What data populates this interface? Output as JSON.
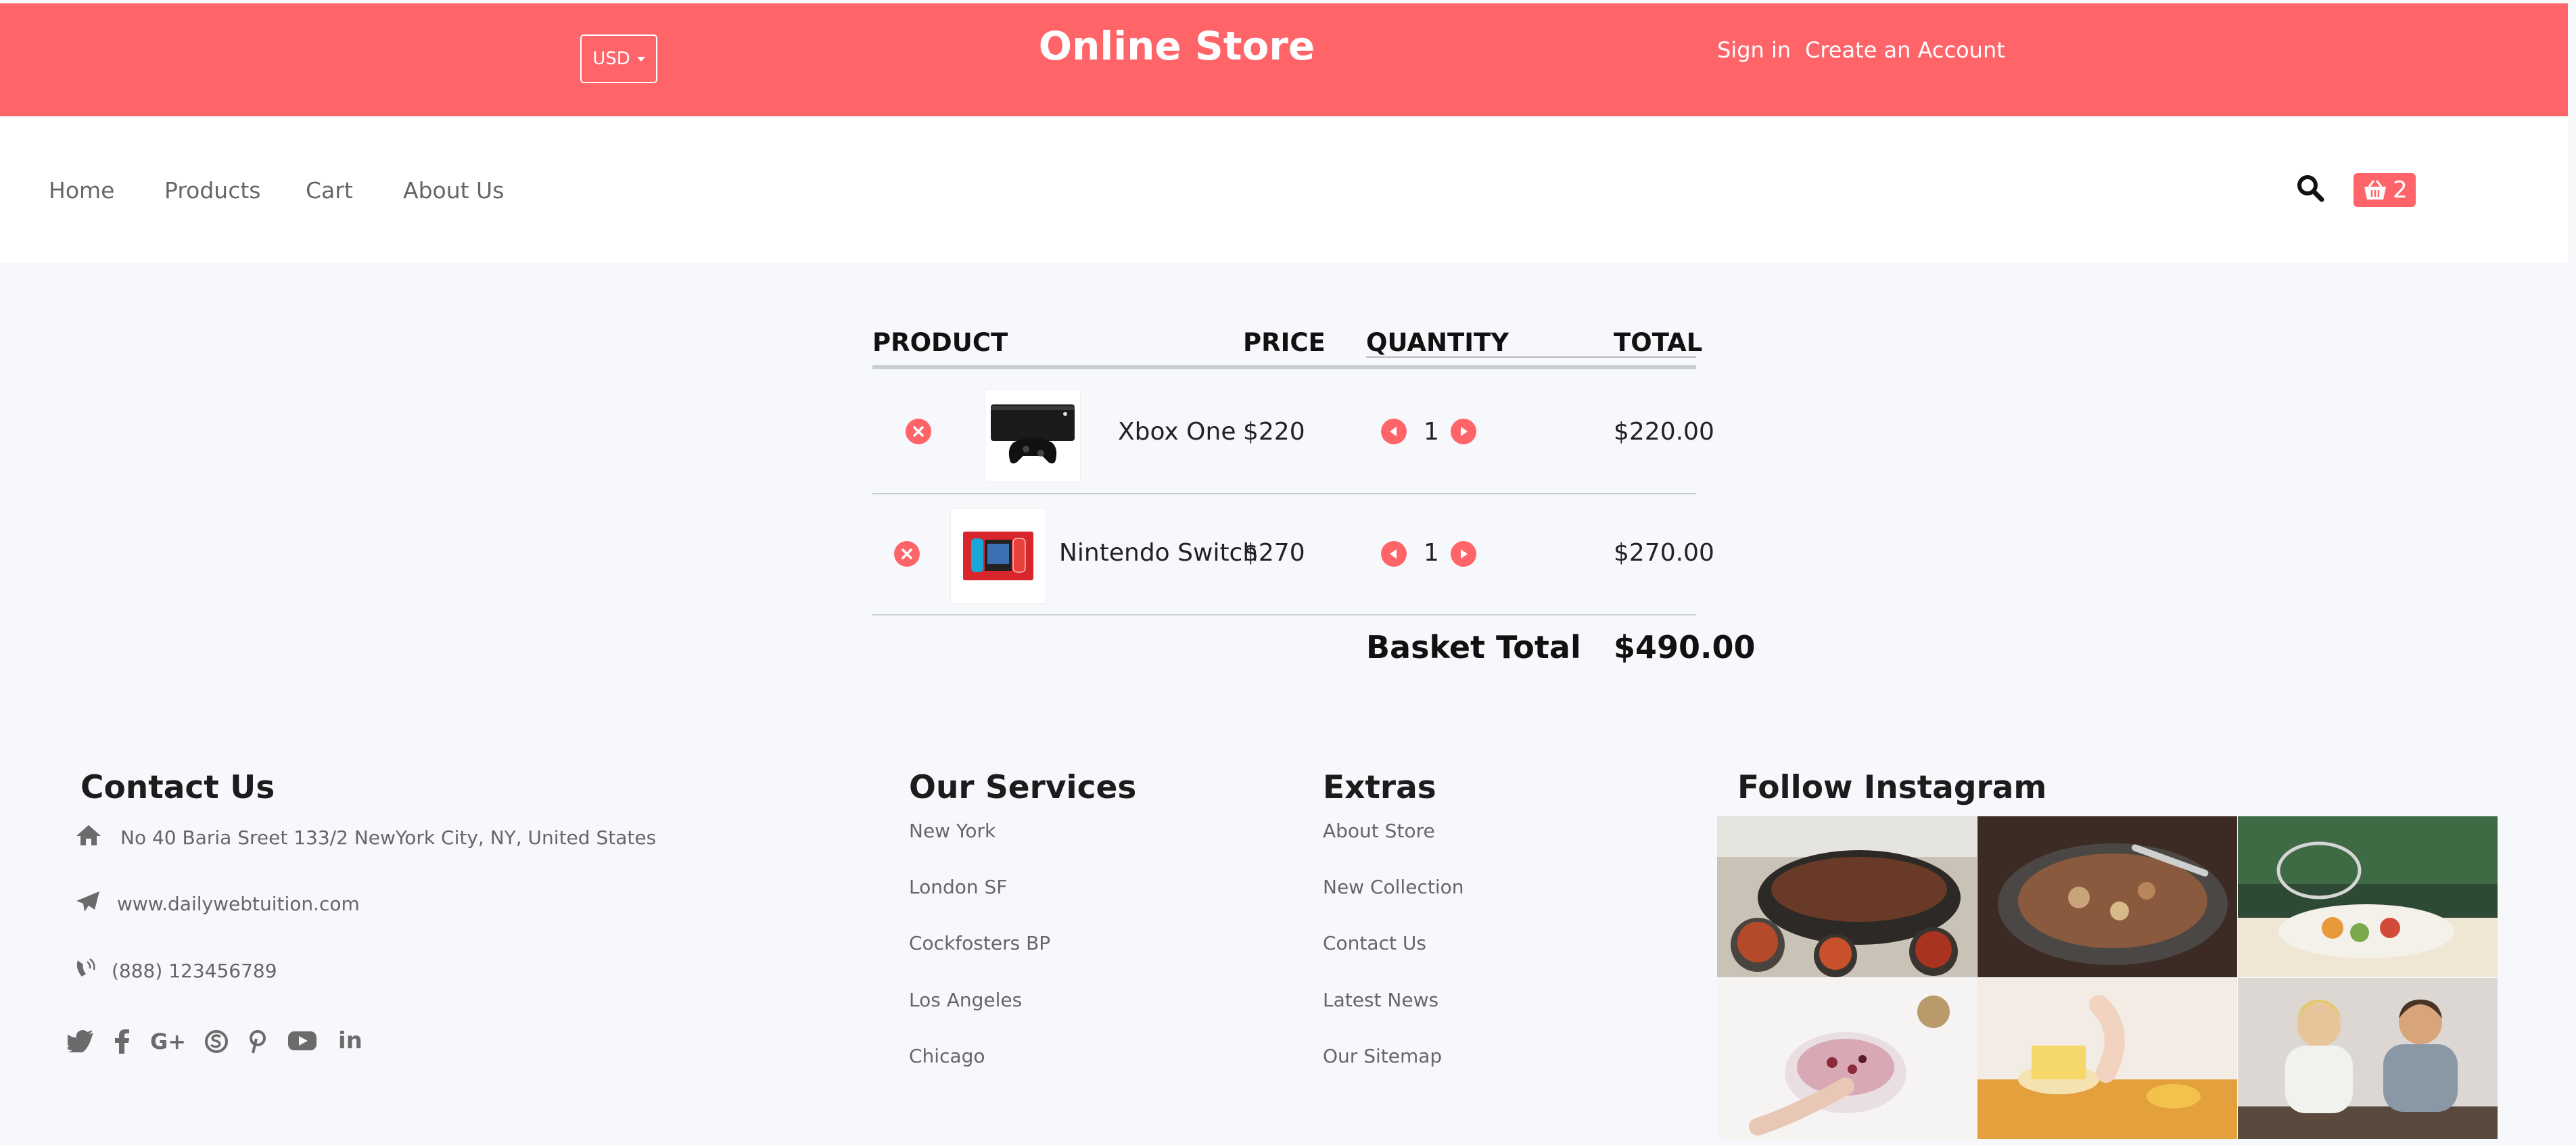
{
  "header": {
    "currency": "USD",
    "brand": "Online Store",
    "sign_in": "Sign in",
    "create_account": "Create an Account"
  },
  "nav": {
    "items": [
      {
        "label": "Home"
      },
      {
        "label": "Products"
      },
      {
        "label": "Cart"
      },
      {
        "label": "About Us"
      }
    ],
    "cart_count": "2"
  },
  "cart": {
    "columns": {
      "product": "PRODUCT",
      "price": "PRICE",
      "quantity": "QUANTITY",
      "total": "TOTAL"
    },
    "rows": [
      {
        "name": "Xbox One",
        "price": "$220",
        "qty": "1",
        "total": "$220.00",
        "image": "xbox-console"
      },
      {
        "name": "Nintendo Switch",
        "price": "$270",
        "qty": "1",
        "total": "$270.00",
        "image": "switch-box"
      }
    ],
    "basket_total_label": "Basket Total",
    "basket_total": "$490.00"
  },
  "footer": {
    "contact": {
      "title": "Contact Us",
      "address": "No 40 Baria Sreet 133/2 NewYork City, NY, United States",
      "website": "www.dailywebtuition.com",
      "phone": "(888) 123456789",
      "social": [
        "twitter",
        "facebook",
        "google-plus",
        "skype",
        "pinterest",
        "youtube",
        "linkedin"
      ]
    },
    "services": {
      "title": "Our Services",
      "items": [
        "New York",
        "London SF",
        "Cockfosters BP",
        "Los Angeles",
        "Chicago"
      ]
    },
    "extras": {
      "title": "Extras",
      "items": [
        "About Store",
        "New Collection",
        "Contact Us",
        "Latest News",
        "Our Sitemap"
      ]
    },
    "instagram": {
      "title": "Follow Instagram",
      "photos": [
        "grill-food",
        "wok-cooking",
        "dessert-table",
        "yogurt-bowl",
        "pastry-cooking",
        "couple-cooking"
      ]
    }
  },
  "colors": {
    "accent": "#ff6469",
    "page_bg": "#f7f8fc",
    "text_muted": "#666666"
  }
}
